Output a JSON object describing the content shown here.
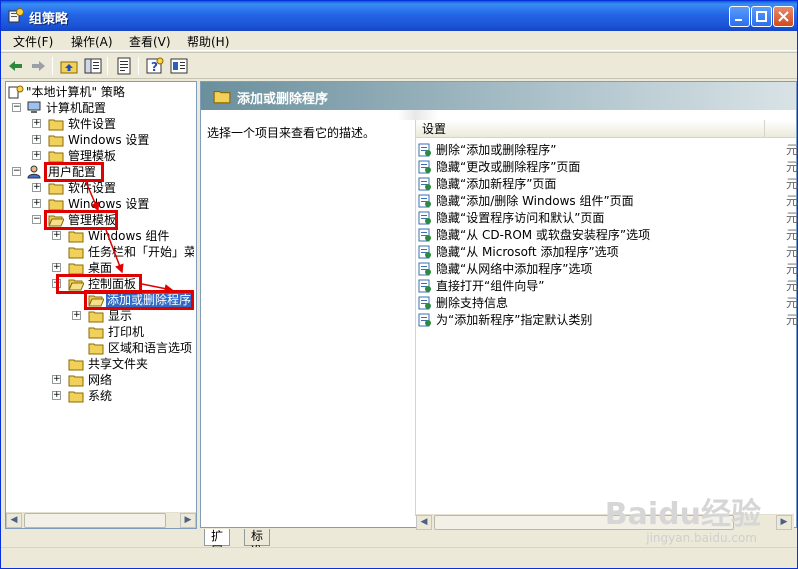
{
  "window": {
    "title": "组策略",
    "colors": {
      "titlebar": "#2365e6",
      "annotation_red": "#e00000",
      "header_bg": "#6a8f9d"
    }
  },
  "menubar": {
    "items": [
      "文件(F)",
      "操作(A)",
      "查看(V)",
      "帮助(H)"
    ]
  },
  "toolbar": {
    "icons": [
      "back-arrow-icon",
      "forward-arrow-icon",
      "up-folder-icon",
      "show-hide-tree-icon",
      "export-list-icon",
      "help-icon",
      "properties-icon"
    ]
  },
  "tree": {
    "root": "\"本地计算机\" 策略",
    "items": [
      {
        "label": "计算机配置"
      },
      {
        "label": "软件设置"
      },
      {
        "label": "Windows 设置"
      },
      {
        "label": "管理模板"
      },
      {
        "label": "用户配置"
      },
      {
        "label": "软件设置"
      },
      {
        "label": "Windows 设置"
      },
      {
        "label": "管理模板"
      },
      {
        "label": "Windows 组件"
      },
      {
        "label": "任务栏和「开始」菜"
      },
      {
        "label": "桌面"
      },
      {
        "label": "控制面板"
      },
      {
        "label": "添加或删除程序"
      },
      {
        "label": "显示"
      },
      {
        "label": "打印机"
      },
      {
        "label": "区域和语言选项"
      },
      {
        "label": "共享文件夹"
      },
      {
        "label": "网络"
      },
      {
        "label": "系统"
      }
    ]
  },
  "right": {
    "header_title": "添加或删除程序",
    "description": "选择一个项目来查看它的描述。",
    "column_header": "设置",
    "settings": [
      "删除“添加或删除程序”",
      "隐藏“更改或删除程序”页面",
      "隐藏“添加新程序”页面",
      "隐藏“添加/删除 Windows 组件”页面",
      "隐藏“设置程序访问和默认”页面",
      "隐藏“从 CD-ROM 或软盘安装程序”选项",
      "隐藏“从 Microsoft 添加程序”选项",
      "隐藏“从网络中添加程序”选项",
      "直接打开“组件向导”",
      "删除支持信息",
      "为“添加新程序”指定默认类别"
    ],
    "tail_glyph": "元"
  },
  "tabs": {
    "extended": "扩展",
    "standard": "标准"
  },
  "watermark": {
    "main": "Baidu经验",
    "sub": "jingyan.baidu.com"
  }
}
